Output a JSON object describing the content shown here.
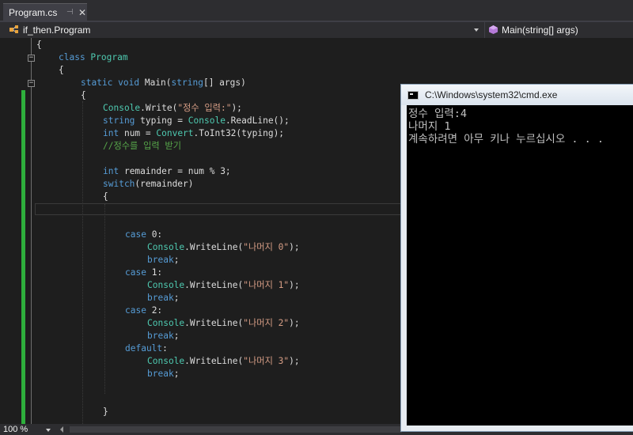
{
  "tab": {
    "label": "Program.cs",
    "pin_glyph": "⊣",
    "close_glyph": "✕"
  },
  "navbar": {
    "class_path": "if_then.Program",
    "method": "Main(string[] args)"
  },
  "status": {
    "zoom": "100 %"
  },
  "console": {
    "title": "C:\\Windows\\system32\\cmd.exe",
    "lines": [
      "정수 입력:4",
      "나머지 1",
      "계속하려면 아무 키나 누르십시오 . . ."
    ]
  },
  "outline_glyph": "−",
  "code": [
    {
      "segments": [
        {
          "t": "{",
          "c": ""
        }
      ]
    },
    {
      "segments": [
        {
          "t": "class ",
          "c": "kw"
        },
        {
          "t": "Program",
          "c": "ty"
        }
      ]
    },
    {
      "segments": [
        {
          "t": "{",
          "c": ""
        }
      ]
    },
    {
      "segments": [
        {
          "t": "static ",
          "c": "kw"
        },
        {
          "t": "void ",
          "c": "kw"
        },
        {
          "t": "Main(",
          "c": ""
        },
        {
          "t": "string",
          "c": "kw"
        },
        {
          "t": "[] args)",
          "c": ""
        }
      ]
    },
    {
      "segments": [
        {
          "t": "{",
          "c": ""
        }
      ]
    },
    {
      "segments": [
        {
          "t": "Console",
          "c": "ty"
        },
        {
          "t": ".Write(",
          "c": ""
        },
        {
          "t": "\"정수 입력:\"",
          "c": "str"
        },
        {
          "t": ");",
          "c": ""
        }
      ]
    },
    {
      "segments": [
        {
          "t": "string ",
          "c": "kw"
        },
        {
          "t": "typing = ",
          "c": ""
        },
        {
          "t": "Console",
          "c": "ty"
        },
        {
          "t": ".ReadLine();",
          "c": ""
        }
      ]
    },
    {
      "segments": [
        {
          "t": "int ",
          "c": "kw"
        },
        {
          "t": "num = ",
          "c": ""
        },
        {
          "t": "Convert",
          "c": "ty"
        },
        {
          "t": ".ToInt32(typing);",
          "c": ""
        }
      ]
    },
    {
      "segments": [
        {
          "t": "//정수를 입력 받기",
          "c": "cm"
        }
      ]
    },
    {
      "segments": []
    },
    {
      "segments": [
        {
          "t": "int ",
          "c": "kw"
        },
        {
          "t": "remainder = num % 3;",
          "c": ""
        }
      ]
    },
    {
      "segments": [
        {
          "t": "switch",
          "c": "kw"
        },
        {
          "t": "(remainder)",
          "c": ""
        }
      ]
    },
    {
      "segments": [
        {
          "t": "{",
          "c": ""
        }
      ]
    },
    {
      "segments": []
    },
    {
      "segments": []
    },
    {
      "segments": [
        {
          "t": "case ",
          "c": "kw"
        },
        {
          "t": "0:",
          "c": ""
        }
      ]
    },
    {
      "segments": [
        {
          "t": "Console",
          "c": "ty"
        },
        {
          "t": ".WriteLine(",
          "c": ""
        },
        {
          "t": "\"나머지 0\"",
          "c": "str"
        },
        {
          "t": ");",
          "c": ""
        }
      ]
    },
    {
      "segments": [
        {
          "t": "break",
          "c": "kw"
        },
        {
          "t": ";",
          "c": ""
        }
      ]
    },
    {
      "segments": [
        {
          "t": "case ",
          "c": "kw"
        },
        {
          "t": "1:",
          "c": ""
        }
      ]
    },
    {
      "segments": [
        {
          "t": "Console",
          "c": "ty"
        },
        {
          "t": ".WriteLine(",
          "c": ""
        },
        {
          "t": "\"나머지 1\"",
          "c": "str"
        },
        {
          "t": ");",
          "c": ""
        }
      ]
    },
    {
      "segments": [
        {
          "t": "break",
          "c": "kw"
        },
        {
          "t": ";",
          "c": ""
        }
      ]
    },
    {
      "segments": [
        {
          "t": "case ",
          "c": "kw"
        },
        {
          "t": "2:",
          "c": ""
        }
      ]
    },
    {
      "segments": [
        {
          "t": "Console",
          "c": "ty"
        },
        {
          "t": ".WriteLine(",
          "c": ""
        },
        {
          "t": "\"나머지 2\"",
          "c": "str"
        },
        {
          "t": ");",
          "c": ""
        }
      ]
    },
    {
      "segments": [
        {
          "t": "break",
          "c": "kw"
        },
        {
          "t": ";",
          "c": ""
        }
      ]
    },
    {
      "segments": [
        {
          "t": "default",
          "c": "kw"
        },
        {
          "t": ":",
          "c": ""
        }
      ]
    },
    {
      "segments": [
        {
          "t": "Console",
          "c": "ty"
        },
        {
          "t": ".WriteLine(",
          "c": ""
        },
        {
          "t": "\"나머지 3\"",
          "c": "str"
        },
        {
          "t": ");",
          "c": ""
        }
      ]
    },
    {
      "segments": [
        {
          "t": "break",
          "c": "kw"
        },
        {
          "t": ";",
          "c": ""
        }
      ]
    },
    {
      "segments": []
    },
    {
      "segments": []
    },
    {
      "segments": [
        {
          "t": "}",
          "c": ""
        }
      ]
    }
  ]
}
